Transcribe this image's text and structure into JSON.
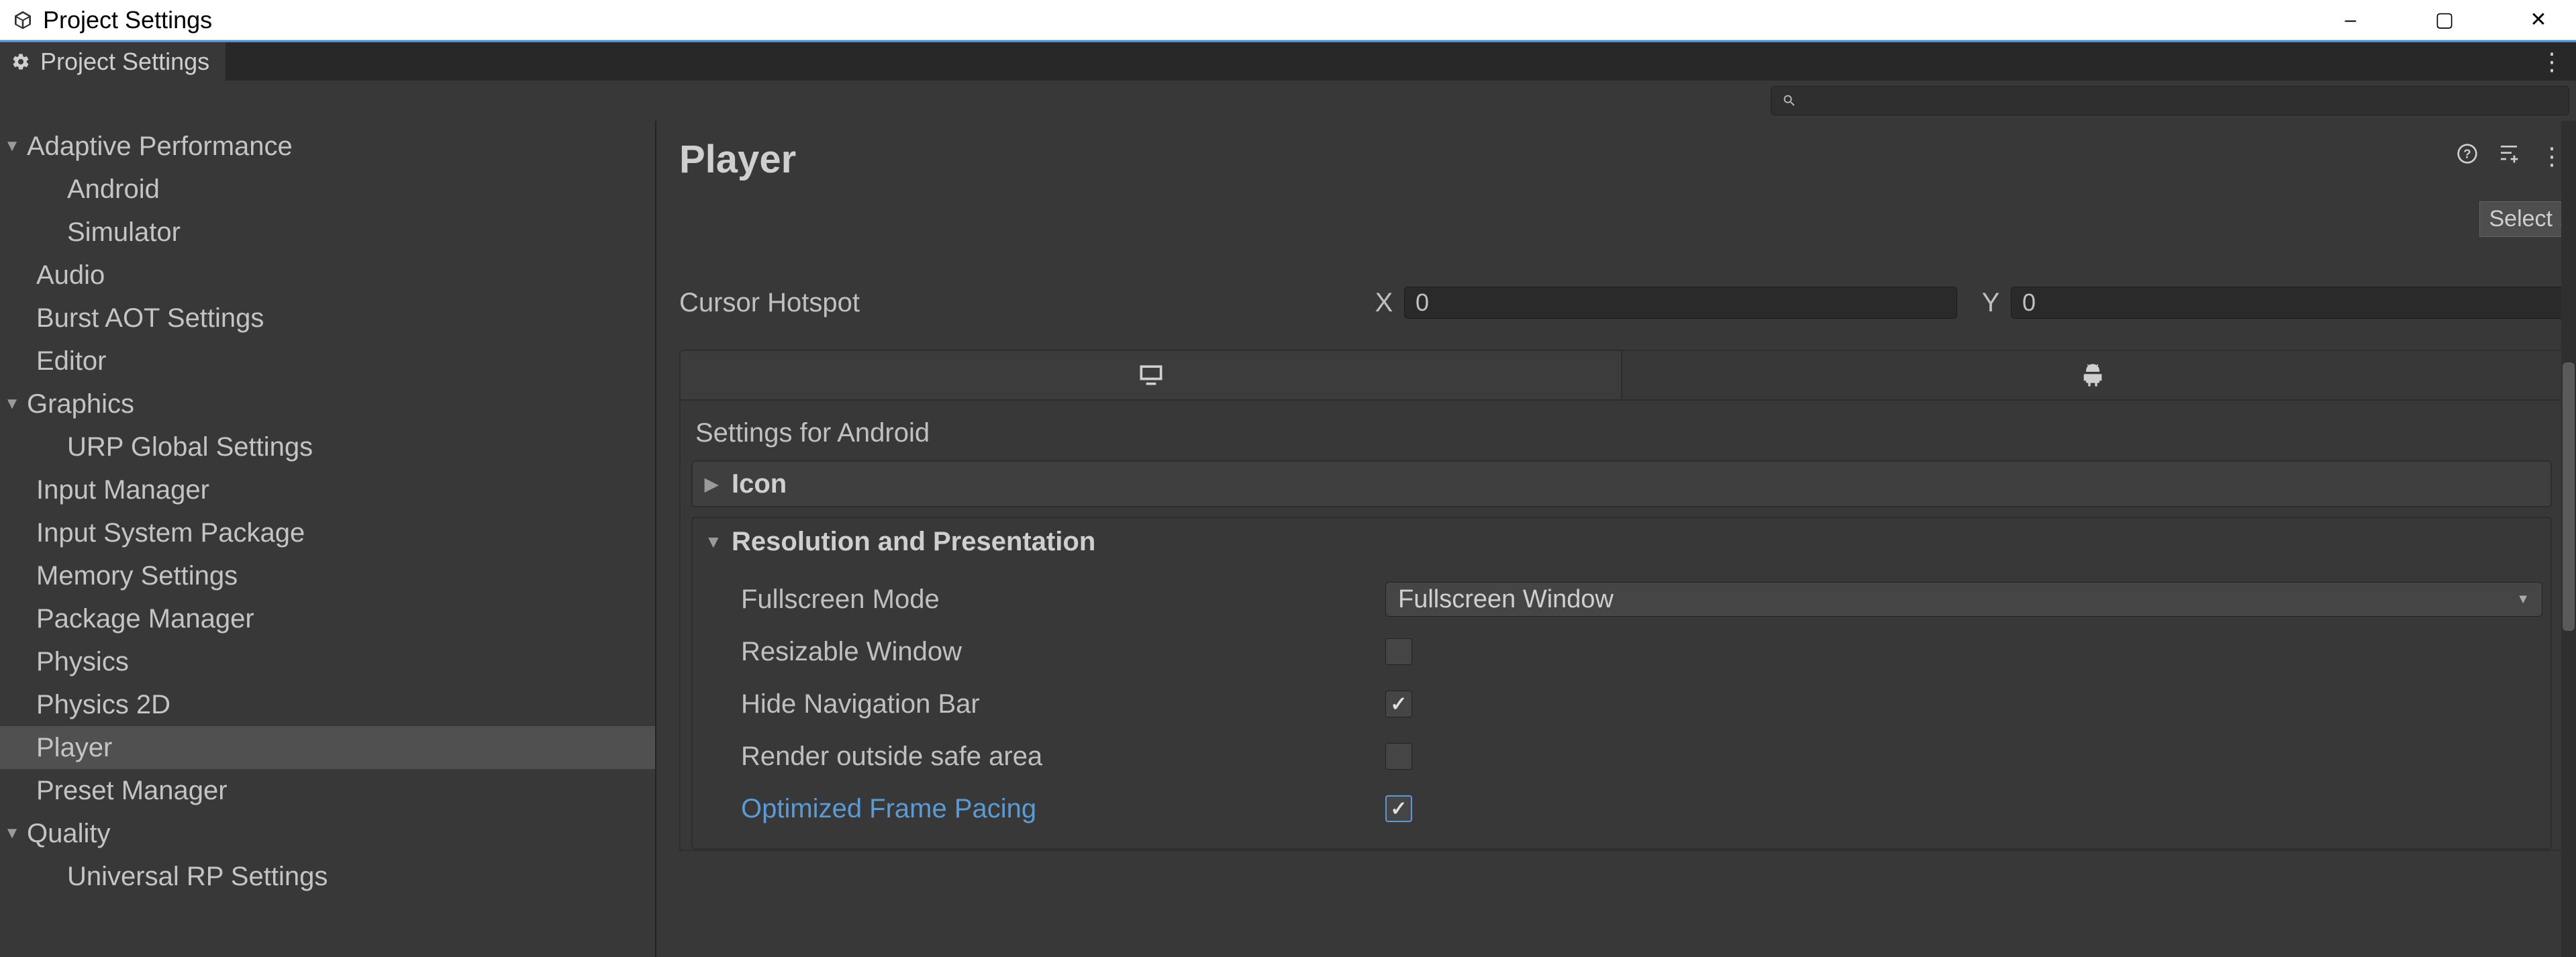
{
  "window": {
    "title": "Project Settings",
    "icons": {
      "minimize": "–",
      "maximize": "▢",
      "close": "✕"
    }
  },
  "tab": {
    "title": "Project Settings",
    "icon": "gear-icon"
  },
  "search": {
    "placeholder": ""
  },
  "sidebar": [
    {
      "label": "Adaptive Performance",
      "level": "expandable",
      "caret": "▼"
    },
    {
      "label": "Android",
      "level": "child"
    },
    {
      "label": "Simulator",
      "level": "child"
    },
    {
      "label": "Audio",
      "level": "top"
    },
    {
      "label": "Burst AOT Settings",
      "level": "top"
    },
    {
      "label": "Editor",
      "level": "top"
    },
    {
      "label": "Graphics",
      "level": "expandable",
      "caret": "▼"
    },
    {
      "label": "URP Global Settings",
      "level": "child"
    },
    {
      "label": "Input Manager",
      "level": "top"
    },
    {
      "label": "Input System Package",
      "level": "top"
    },
    {
      "label": "Memory Settings",
      "level": "top"
    },
    {
      "label": "Package Manager",
      "level": "top"
    },
    {
      "label": "Physics",
      "level": "top"
    },
    {
      "label": "Physics 2D",
      "level": "top"
    },
    {
      "label": "Player",
      "level": "top",
      "selected": true
    },
    {
      "label": "Preset Manager",
      "level": "top"
    },
    {
      "label": "Quality",
      "level": "expandable",
      "caret": "▼"
    },
    {
      "label": "Universal RP Settings",
      "level": "child"
    }
  ],
  "main": {
    "title": "Player",
    "select_button": "Select",
    "cursor_hotspot": {
      "label": "Cursor Hotspot",
      "x_label": "X",
      "x_value": "0",
      "y_label": "Y",
      "y_value": "0"
    },
    "platform_tabs": {
      "desktop": "desktop-icon",
      "android": "android-icon",
      "active": "android"
    },
    "android_section": {
      "heading": "Settings for Android",
      "icon_foldout": {
        "label": "Icon",
        "expanded": false
      },
      "res_foldout": {
        "label": "Resolution and Presentation",
        "expanded": true
      },
      "fields": {
        "fullscreen_mode": {
          "label": "Fullscreen Mode",
          "value": "Fullscreen Window"
        },
        "resizable_window": {
          "label": "Resizable Window",
          "checked": false
        },
        "hide_nav": {
          "label": "Hide Navigation Bar",
          "checked": true
        },
        "render_outside": {
          "label": "Render outside safe area",
          "checked": false
        },
        "optimized_frame_pacing": {
          "label": "Optimized Frame Pacing",
          "checked": true,
          "highlight": true
        }
      }
    }
  }
}
